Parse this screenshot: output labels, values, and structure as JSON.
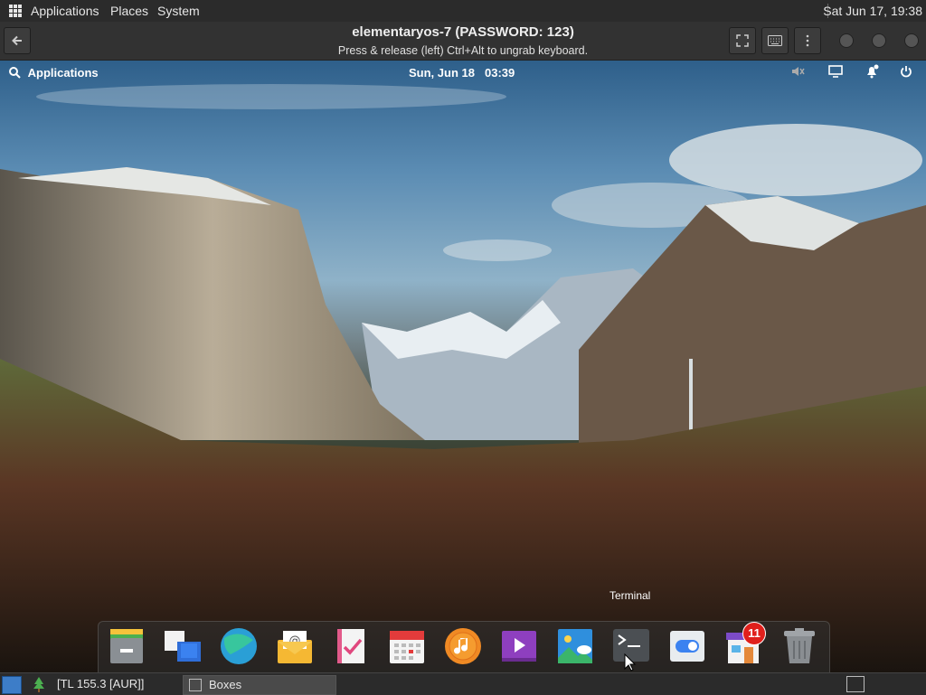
{
  "host_panel": {
    "menus": [
      "Applications",
      "Places",
      "System"
    ],
    "clock": "Sat Jun 17, 19:38"
  },
  "vm_window": {
    "title": "elementaryos-7 (PASSWORD: 123)",
    "subtitle": "Press & release (left) Ctrl+Alt to ungrab keyboard."
  },
  "guest_panel": {
    "applications_label": "Applications",
    "date": "Sun, Jun 18",
    "time": "03:39",
    "indicators": [
      "sound-muted-icon",
      "display-icon",
      "notifications-icon",
      "power-icon"
    ]
  },
  "dock": {
    "tooltip": "Terminal",
    "items": [
      {
        "name": "Files",
        "icon": "files-icon"
      },
      {
        "name": "Multitasking View",
        "icon": "multitasking-icon"
      },
      {
        "name": "Web",
        "icon": "web-browser-icon"
      },
      {
        "name": "Mail",
        "icon": "mail-icon"
      },
      {
        "name": "Tasks",
        "icon": "tasks-icon"
      },
      {
        "name": "Calendar",
        "icon": "calendar-icon"
      },
      {
        "name": "Music",
        "icon": "music-icon"
      },
      {
        "name": "Videos",
        "icon": "videos-icon"
      },
      {
        "name": "Photos",
        "icon": "photos-icon"
      },
      {
        "name": "Terminal",
        "icon": "terminal-icon"
      },
      {
        "name": "System Settings",
        "icon": "settings-toggle-icon"
      },
      {
        "name": "AppCenter",
        "icon": "appcenter-icon",
        "badge": "11"
      },
      {
        "name": "Trash",
        "icon": "trash-icon"
      }
    ]
  },
  "taskbar": {
    "tl_label": "[TL 155.3 [AUR]]",
    "task_label": "Boxes"
  },
  "colors": {
    "panel_bg": "#2b2b2b",
    "header_bg": "#323232",
    "badge_red": "#e0201c",
    "accent_blue": "#3d7dc8"
  }
}
